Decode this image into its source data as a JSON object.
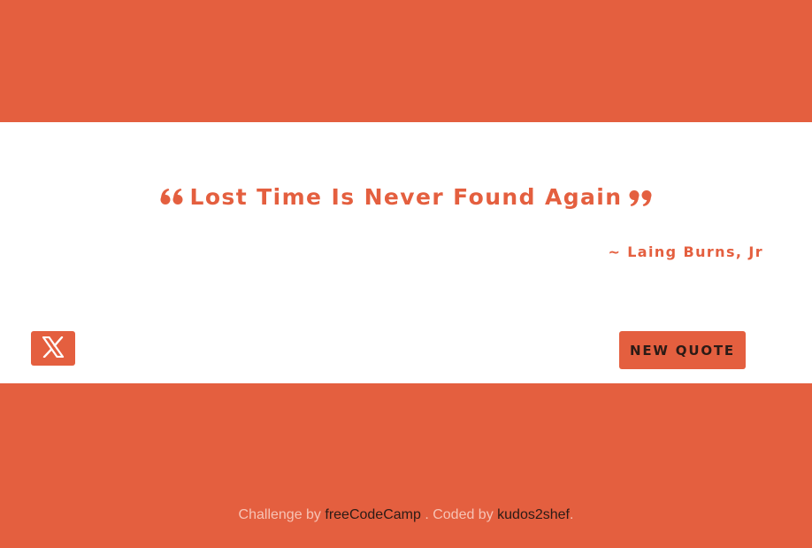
{
  "colors": {
    "accent": "#E45F3F",
    "card_background": "#FFFFFF",
    "footer_text": "#F6C3B5",
    "link_text": "#2B1B16"
  },
  "quote": {
    "text": "Lost Time Is Never Found Again",
    "author": "~ Laing Burns, Jr",
    "open_icon": "quote-left-icon",
    "close_icon": "quote-right-icon"
  },
  "actions": {
    "tweet_icon": "x-twitter-icon",
    "new_quote_label": "NEW QUOTE"
  },
  "footer": {
    "prefix": "Challenge by ",
    "challenge_link": "freeCodeCamp",
    "middle": " . Coded by ",
    "author_link": "kudos2shef",
    "suffix": "."
  }
}
